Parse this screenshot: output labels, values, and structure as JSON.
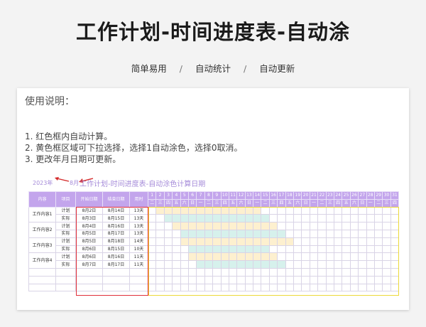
{
  "page": {
    "title": "工作计划-时间进度表-自动涂",
    "tags": [
      "简单易用",
      "自动统计",
      "自动更新"
    ]
  },
  "usage": {
    "title": "使用说明：",
    "items": [
      "1. 红色框内自动计算。",
      "2. 黄色框区域可下拉选择，选择1自动涂色，选择0取消。",
      "3. 更改年月日期可更新。"
    ]
  },
  "sheet": {
    "year": "2023年",
    "month": "8月",
    "title": "工作计划-时间进度表-自动涂色计算日期",
    "headers": [
      "内容",
      "项目",
      "开始日期",
      "结束日期",
      "用时"
    ],
    "days": [
      "1",
      "2",
      "3",
      "4",
      "5",
      "6",
      "7",
      "8",
      "9",
      "10",
      "11",
      "12",
      "13",
      "14",
      "15",
      "16",
      "17",
      "18",
      "19",
      "20",
      "21",
      "22",
      "23",
      "24",
      "25",
      "26",
      "27",
      "28",
      "29",
      "30",
      "31"
    ],
    "weekdays": [
      "二",
      "三",
      "四",
      "五",
      "六",
      "日",
      "一",
      "二",
      "三",
      "四",
      "五",
      "六",
      "日",
      "一",
      "二",
      "三",
      "四",
      "五",
      "六",
      "日",
      "一",
      "二",
      "三",
      "四",
      "五",
      "六",
      "日",
      "一",
      "二",
      "三",
      "四"
    ],
    "groups": [
      {
        "name": "工作内容1",
        "rows": [
          {
            "type": "计划",
            "start": "8月2日",
            "end": "8月14日",
            "days": "13天",
            "from": 2,
            "to": 14,
            "color": "yellow"
          },
          {
            "type": "实际",
            "start": "8月3日",
            "end": "8月15日",
            "days": "13天",
            "from": 3,
            "to": 15,
            "color": "cyan"
          }
        ]
      },
      {
        "name": "工作内容2",
        "rows": [
          {
            "type": "计划",
            "start": "8月4日",
            "end": "8月16日",
            "days": "13天",
            "from": 4,
            "to": 16,
            "color": "yellow"
          },
          {
            "type": "实际",
            "start": "8月5日",
            "end": "8月17日",
            "days": "13天",
            "from": 5,
            "to": 17,
            "color": "cyan"
          }
        ]
      },
      {
        "name": "工作内容3",
        "rows": [
          {
            "type": "计划",
            "start": "8月5日",
            "end": "8月18日",
            "days": "14天",
            "from": 5,
            "to": 18,
            "color": "yellow"
          },
          {
            "type": "实际",
            "start": "8月6日",
            "end": "8月15日",
            "days": "10天",
            "from": 6,
            "to": 15,
            "color": "cyan"
          }
        ]
      },
      {
        "name": "工作内容4",
        "rows": [
          {
            "type": "计划",
            "start": "8月6日",
            "end": "8月16日",
            "days": "11天",
            "from": 6,
            "to": 16,
            "color": "yellow"
          },
          {
            "type": "实际",
            "start": "8月7日",
            "end": "8月17日",
            "days": "11天",
            "from": 7,
            "to": 17,
            "color": "cyan"
          }
        ]
      }
    ],
    "colors": {
      "header": "#c3a5ec",
      "yellow": "#fdf0cf",
      "cyan": "#d6f1ec",
      "red_box": "#e0303a",
      "yellow_box": "#ecd93a"
    }
  }
}
